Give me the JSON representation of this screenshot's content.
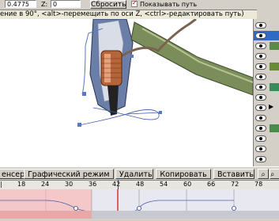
{
  "toolbar": {
    "x_value": "0.4775",
    "z_label": "Z:",
    "z_value": "0",
    "reset_label": "Сбросить",
    "show_path_label": "Показывать путь"
  },
  "status": {
    "text": "ение в 90°, <alt>-перемещить по оси Z, <ctrl>-редактировать путь)"
  },
  "bottombar": {
    "tab_sensor": "енсер",
    "tab_graph": "Графический режим",
    "delete_label": "Удалить",
    "copy_label": "Копировать",
    "paste_label": "Вставить"
  },
  "ruler": {
    "ticks": [
      "18",
      "24",
      "30",
      "36",
      "42",
      "48",
      "54",
      "60",
      "66",
      "72",
      "78"
    ]
  },
  "colors": {
    "timeline_range": "#f4c8c8",
    "playhead": "#e00000",
    "selection": "#316ac5"
  }
}
